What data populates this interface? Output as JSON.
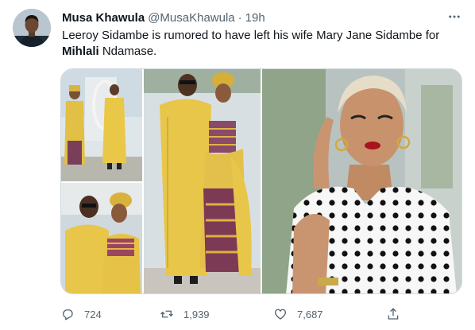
{
  "author": {
    "name": "Musa Khawula",
    "handle": "@MusaKhawula",
    "separator": "·",
    "time": "19h"
  },
  "tweet": {
    "text_before": "Leeroy Sidambe is rumored to have left his wife Mary Jane Sidambe for ",
    "text_bold": "Mihlali",
    "text_after": " Ndamase."
  },
  "media": {
    "photos": [
      "couple-walking-outdoors",
      "couple-close-up-selfie",
      "couple-in-traditional-attire",
      "woman-polka-dot-portrait"
    ]
  },
  "actions": {
    "reply": {
      "icon": "reply-icon",
      "count": "724"
    },
    "retweet": {
      "icon": "retweet-icon",
      "count": "1,939"
    },
    "like": {
      "icon": "heart-icon",
      "count": "7,687"
    },
    "share": {
      "icon": "share-icon"
    }
  },
  "colors": {
    "text": "#0f1419",
    "secondary": "#536471",
    "border": "#cfd9de",
    "attire_yellow": "#e8c64a"
  }
}
